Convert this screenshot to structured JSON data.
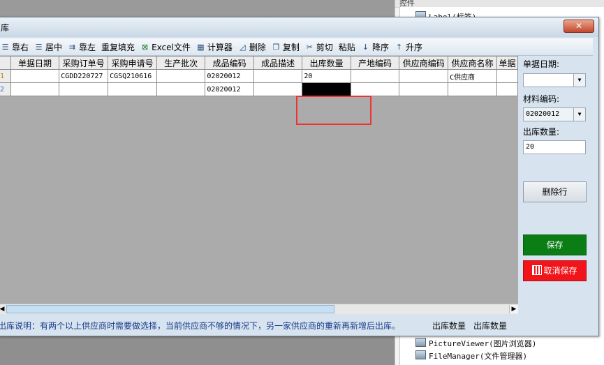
{
  "background": {
    "panel_header": "控件",
    "tree_items": [
      {
        "label": "Label(标签)",
        "icon": "label-icon"
      },
      {
        "label": "PictureViewer(图片浏览器)",
        "icon": "picture-viewer-icon"
      },
      {
        "label": "FileManager(文件管理器)",
        "icon": "file-manager-icon"
      }
    ]
  },
  "dialog": {
    "title": "库",
    "close_label": "✕"
  },
  "toolbar": {
    "items": [
      {
        "label": "靠右",
        "icon": "align-right-icon"
      },
      {
        "label": "居中",
        "icon": "align-center-icon"
      },
      {
        "label": "靠左",
        "icon": "align-left-icon"
      },
      {
        "label": "重复填充",
        "icon": ""
      },
      {
        "label": "Excel文件",
        "icon": "excel-icon"
      },
      {
        "label": "计算器",
        "icon": "calculator-icon"
      },
      {
        "label": "删除",
        "icon": "eraser-icon"
      },
      {
        "label": "复制",
        "icon": "copy-icon"
      },
      {
        "label": "剪切",
        "icon": "scissors-icon"
      },
      {
        "label": "粘贴",
        "icon": ""
      },
      {
        "label": "降序",
        "icon": "sort-desc-icon"
      },
      {
        "label": "升序",
        "icon": "sort-asc-icon"
      }
    ]
  },
  "grid": {
    "columns": [
      "",
      "单据日期",
      "采购订单号",
      "采购申请号",
      "生产批次",
      "成品编码",
      "成品描述",
      "出库数量",
      "产地编码",
      "供应商编码",
      "供应商名称",
      "单据"
    ],
    "rows": [
      [
        "1",
        "",
        "CGDD220727",
        "CGSQ210616",
        "",
        "02020012",
        "",
        "20",
        "",
        "",
        "C供应商",
        ""
      ],
      [
        "2",
        "",
        "",
        "",
        "",
        "02020012",
        "",
        "",
        "",
        "",
        "",
        ""
      ]
    ]
  },
  "note": "出库说明：有两个以上供应商时需要做选择，当前供应商不够的情况下，另一家供应商的重新再新增后出库。",
  "footer": {
    "label1": "出库数量",
    "label2": "出库数量"
  },
  "side": {
    "date_label": "单据日期:",
    "date_value": "",
    "material_label": "材料编码:",
    "material_value": "02020012",
    "qty_label": "出库数量:",
    "qty_value": "20",
    "delete_row_label": "删除行",
    "save_label": "保存",
    "cancel_label": "取消保存"
  },
  "colors": {
    "save": "#0a7d15",
    "cancel": "#f2141b",
    "highlight": "#e33333"
  }
}
